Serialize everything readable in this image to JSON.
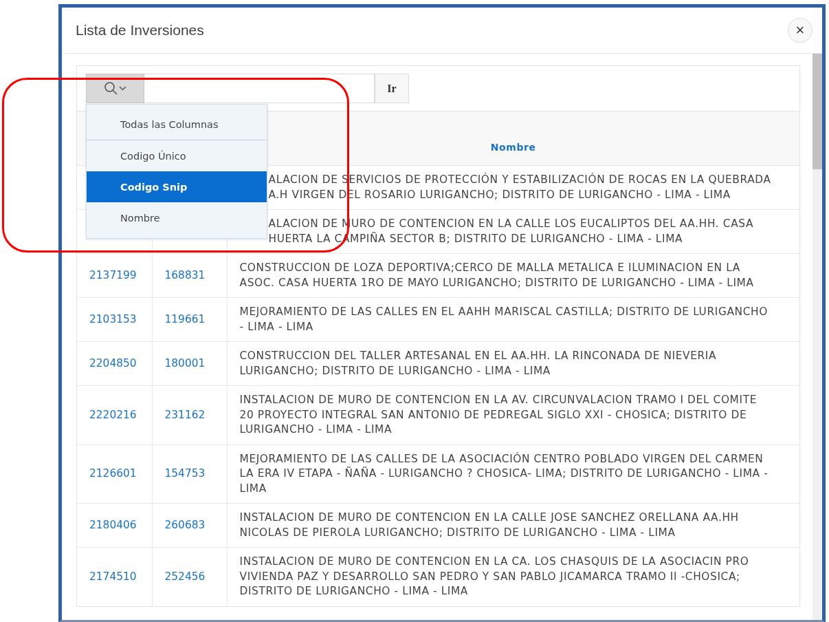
{
  "dialog": {
    "title": "Lista de Inversiones",
    "close_label": "×"
  },
  "search": {
    "column_menu_open": true,
    "go_label": "Ir"
  },
  "column_menu": [
    {
      "label": "Todas las Columnas",
      "selected": false
    },
    {
      "label": "Codigo Único",
      "selected": false
    },
    {
      "label": "Codigo Snip",
      "selected": true
    },
    {
      "label": "Nombre",
      "selected": false
    }
  ],
  "table": {
    "columns": [
      "Nombre"
    ],
    "rows": [
      {
        "nombre": "ALACION DE SERVICIOS DE PROTECCIÓN Y ESTABILIZACIÓN DE ROCAS EN LA QUEBRADA A.H VIRGEN DEL ROSARIO LURIGANCHO; DISTRITO DE LURIGANCHO - LIMA - LIMA"
      },
      {
        "nombre": "ALACION DE MURO DE CONTENCION EN LA CALLE LOS EUCALIPTOS DEL AA.HH. CASA HUERTA LA CAMPIÑA SECTOR B; DISTRITO DE LURIGANCHO - LIMA - LIMA"
      },
      {
        "codigo_unico": "2137199",
        "codigo_snip": "168831",
        "nombre": "CONSTRUCCION DE LOZA DEPORTIVA;CERCO DE MALLA METALICA E ILUMINACION EN LA ASOC. CASA HUERTA 1RO DE MAYO LURIGANCHO; DISTRITO DE LURIGANCHO - LIMA - LIMA"
      },
      {
        "codigo_unico": "2103153",
        "codigo_snip": "119661",
        "nombre": "MEJORAMIENTO DE LAS CALLES EN EL AAHH MARISCAL CASTILLA; DISTRITO DE LURIGANCHO - LIMA - LIMA"
      },
      {
        "codigo_unico": "2204850",
        "codigo_snip": "180001",
        "nombre": "CONSTRUCCION DEL TALLER ARTESANAL EN EL AA.HH. LA RINCONADA DE NIEVERIA LURIGANCHO; DISTRITO DE LURIGANCHO - LIMA - LIMA"
      },
      {
        "codigo_unico": "2220216",
        "codigo_snip": "231162",
        "nombre": "INSTALACION DE MURO DE CONTENCION EN LA AV. CIRCUNVALACION TRAMO I DEL COMITE 20 PROYECTO INTEGRAL SAN ANTONIO DE PEDREGAL SIGLO XXI - CHOSICA; DISTRITO DE LURIGANCHO - LIMA - LIMA"
      },
      {
        "codigo_unico": "2126601",
        "codigo_snip": "154753",
        "nombre": "MEJORAMIENTO DE LAS CALLES DE LA ASOCIACIÓN CENTRO POBLADO VIRGEN DEL CARMEN LA ERA IV ETAPA - ÑAÑA - LURIGANCHO ? CHOSICA- LIMA; DISTRITO DE LURIGANCHO - LIMA - LIMA"
      },
      {
        "codigo_unico": "2180406",
        "codigo_snip": "260683",
        "nombre": "INSTALACION DE MURO DE CONTENCION EN LA CALLE JOSE SANCHEZ ORELLANA AA.HH NICOLAS DE PIEROLA LURIGANCHO; DISTRITO DE LURIGANCHO - LIMA - LIMA"
      },
      {
        "codigo_unico": "2174510",
        "codigo_snip": "252456",
        "nombre": "INSTALACION DE MURO DE CONTENCION EN LA CA. LOS CHASQUIS DE LA ASOCIACIN PRO VIVIENDA PAZ Y DESARROLLO SAN PEDRO Y SAN PABLO JICAMARCA TRAMO II -CHOSICA; DISTRITO DE LURIGANCHO - LIMA - LIMA"
      }
    ]
  }
}
